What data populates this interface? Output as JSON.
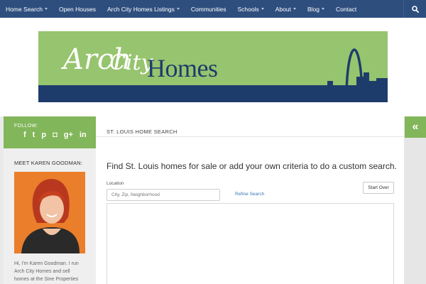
{
  "nav": {
    "items": [
      {
        "label": "Home Search",
        "has_dropdown": true
      },
      {
        "label": "Open Houses",
        "has_dropdown": false
      },
      {
        "label": "Arch City Homes Listings",
        "has_dropdown": true
      },
      {
        "label": "Communities",
        "has_dropdown": false
      },
      {
        "label": "Schools",
        "has_dropdown": true
      },
      {
        "label": "About",
        "has_dropdown": true
      },
      {
        "label": "Blog",
        "has_dropdown": true
      },
      {
        "label": "Contact",
        "has_dropdown": false
      }
    ],
    "search_icon": "search-icon",
    "background": "#2e4e7e"
  },
  "banner": {
    "logo_arch": "Arch",
    "logo_city": "City",
    "logo_homes": "Homes",
    "green": "#97c46e",
    "navy": "#1e3c6b"
  },
  "sidebar": {
    "follow_label": "FOLLOW:",
    "social_icons": [
      "facebook-icon",
      "twitter-icon",
      "pinterest-icon",
      "instagram-icon",
      "google-plus-icon",
      "linkedin-icon"
    ],
    "social_glyphs": [
      "f",
      "t",
      "p",
      "◘",
      "g+",
      "in"
    ],
    "meet_title": "MEET KAREN GOODMAN:",
    "bio": "Hi, I'm Karen Goodman. I run Arch City Homes and sell homes at the Sine Properties",
    "accent": "#82b65a"
  },
  "main": {
    "breadcrumb": "ST. LOUIS HOME SEARCH",
    "headline": "Find St. Louis homes for sale  or add your own criteria to do a custom search.",
    "location_label": "Location",
    "location_placeholder": "City, Zip, Neighborhood",
    "refine_label": "Refine Search",
    "start_over_label": "Start Over"
  },
  "right": {
    "toggle_glyph": "«"
  }
}
